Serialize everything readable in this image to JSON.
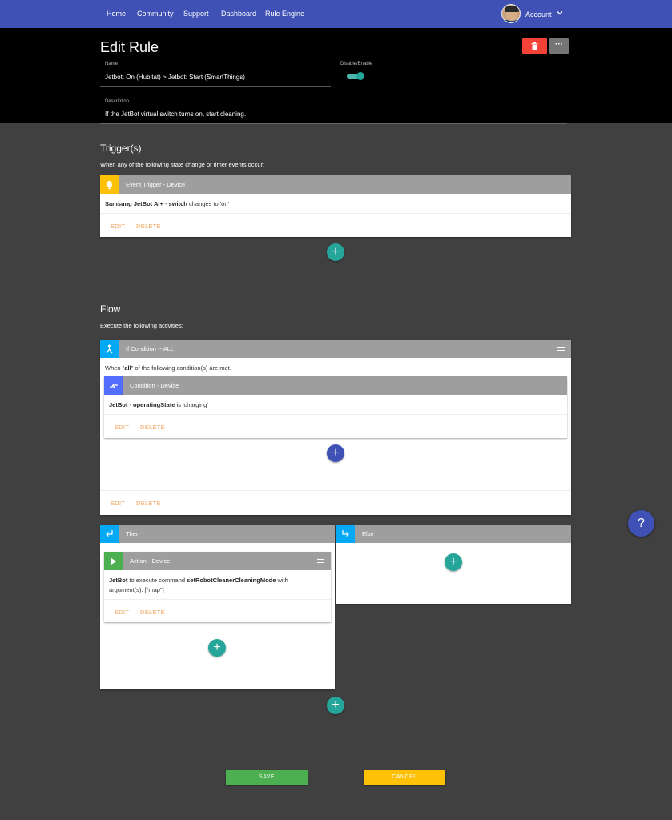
{
  "nav": {
    "items": [
      "Home",
      "Community",
      "Support",
      "Dashboard",
      "Rule Engine"
    ],
    "account_label": "Account"
  },
  "header": {
    "title": "Edit Rule",
    "more_label": "···",
    "name_label": "Name",
    "name_value": "Jetbot: On (Hubitat) > Jetbot: Start (SmartThings)",
    "toggle_label": "Disable/Enable",
    "description_label": "Description",
    "description_value": "If the JetBot virtual switch turns on, start cleaning."
  },
  "triggers": {
    "title": "Trigger(s)",
    "subtitle": "When any of the following state change or timer events occur:",
    "card": {
      "title": "Event Trigger - Device",
      "device": "Samsung JetBot AI+",
      "sep": " - ",
      "attribute": "switch",
      "rest": " changes to 'on'",
      "edit": "EDIT",
      "delete": "DELETE"
    }
  },
  "flow": {
    "title": "Flow",
    "subtitle": "Execute the following activities:",
    "if_card": {
      "title": "If Condition -- ALL",
      "text_pre": "When \"",
      "text_bold": "all",
      "text_post": "\" of the following condition(s) are met.",
      "edit": "EDIT",
      "delete": "DELETE",
      "condition": {
        "title": "Condition - Device",
        "device": "JetBot",
        "sep": " - ",
        "attribute": "operatingState",
        "rest": " is 'charging'",
        "edit": "EDIT",
        "delete": "DELETE"
      }
    },
    "then_card": {
      "title": "Then",
      "action": {
        "title": "Action - Device",
        "device": "JetBot",
        "mid": " to execute command ",
        "command": "setRobotCleanerCleaningMode",
        "post": " with",
        "line2": "argument(s): [\"map\"]",
        "edit": "EDIT",
        "delete": "DELETE"
      }
    },
    "else_card": {
      "title": "Else"
    }
  },
  "fab_plus": "+",
  "help_label": "?",
  "footer": {
    "save": "SAVE",
    "cancel": "CANCEL"
  },
  "colors": {
    "nav": "#3f51b5",
    "trigger_accent": "#ffc107",
    "flow_accent": "#03a9f4",
    "condition_accent": "#536dfe",
    "action_accent": "#4caf50",
    "teal": "#26a69a",
    "link": "#f0a35c"
  }
}
